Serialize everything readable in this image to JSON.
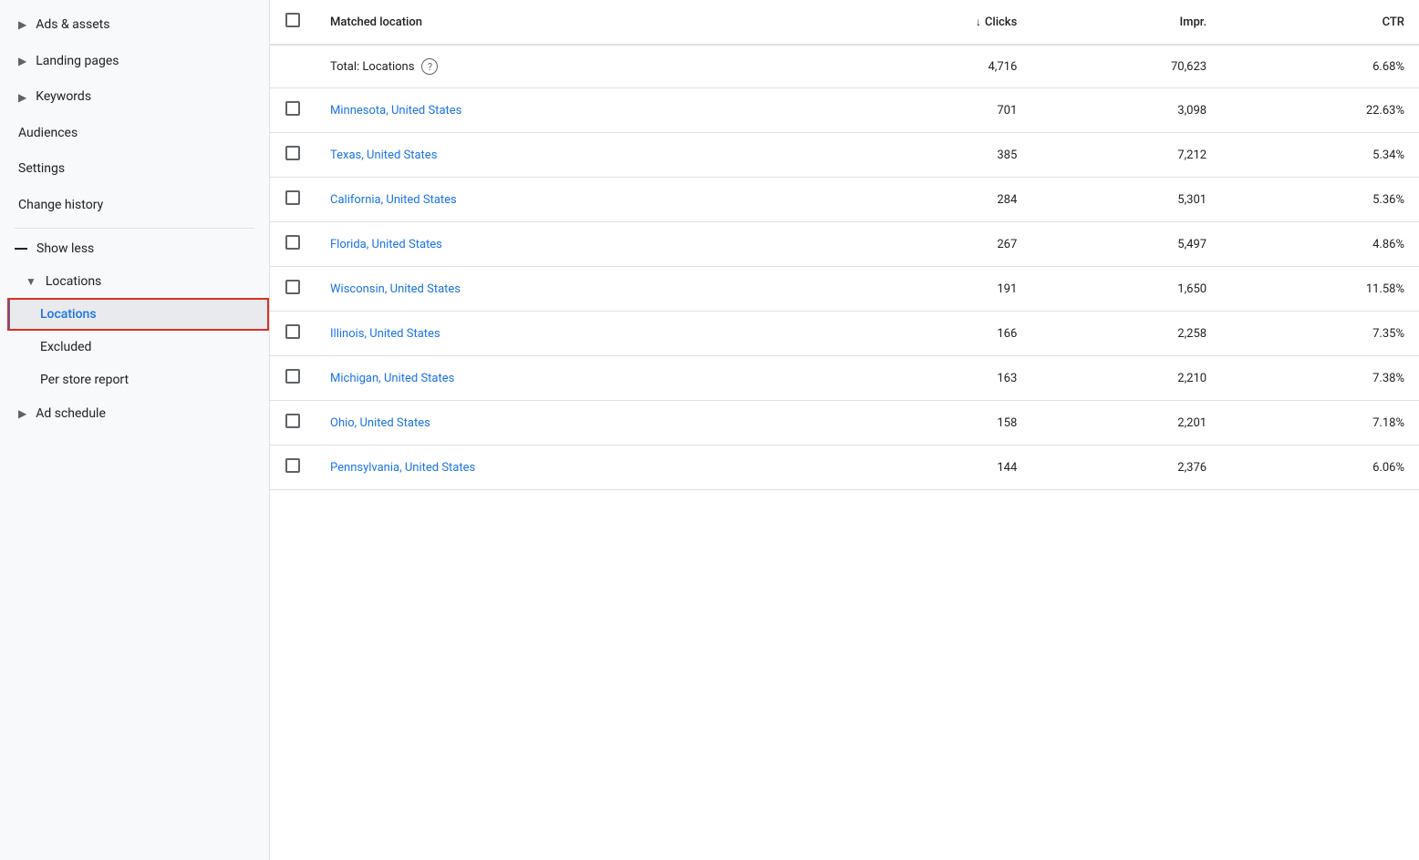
{
  "sidebar": {
    "items": [
      {
        "id": "ads-assets",
        "label": "Ads & assets",
        "type": "expand",
        "arrow": "▶"
      },
      {
        "id": "landing-pages",
        "label": "Landing pages",
        "type": "expand",
        "arrow": "▶"
      },
      {
        "id": "keywords",
        "label": "Keywords",
        "type": "expand",
        "arrow": "▶"
      },
      {
        "id": "audiences",
        "label": "Audiences",
        "type": "plain"
      },
      {
        "id": "settings",
        "label": "Settings",
        "type": "plain"
      },
      {
        "id": "change-history",
        "label": "Change history",
        "type": "plain"
      }
    ],
    "show_less_label": "Show less",
    "locations_section": {
      "header_label": "Locations",
      "arrow": "▼",
      "sub_items": [
        {
          "id": "locations",
          "label": "Locations",
          "active": true
        },
        {
          "id": "excluded",
          "label": "Excluded",
          "active": false
        },
        {
          "id": "per-store-report",
          "label": "Per store report",
          "active": false
        }
      ]
    },
    "ad_schedule": {
      "label": "Ad schedule",
      "arrow": "▶"
    }
  },
  "table": {
    "columns": [
      {
        "id": "checkbox",
        "label": "",
        "type": "checkbox"
      },
      {
        "id": "location",
        "label": "Matched location",
        "type": "text",
        "align": "left"
      },
      {
        "id": "clicks",
        "label": "Clicks",
        "sort": "desc",
        "align": "right"
      },
      {
        "id": "impr",
        "label": "Impr.",
        "align": "right"
      },
      {
        "id": "ctr",
        "label": "CTR",
        "align": "right"
      }
    ],
    "total_row": {
      "label": "Total: Locations",
      "clicks": "4,716",
      "impr": "70,623",
      "ctr": "6.68%"
    },
    "rows": [
      {
        "location": "Minnesota, United States",
        "clicks": "701",
        "impr": "3,098",
        "ctr": "22.63%"
      },
      {
        "location": "Texas, United States",
        "clicks": "385",
        "impr": "7,212",
        "ctr": "5.34%"
      },
      {
        "location": "California, United States",
        "clicks": "284",
        "impr": "5,301",
        "ctr": "5.36%"
      },
      {
        "location": "Florida, United States",
        "clicks": "267",
        "impr": "5,497",
        "ctr": "4.86%"
      },
      {
        "location": "Wisconsin, United States",
        "clicks": "191",
        "impr": "1,650",
        "ctr": "11.58%"
      },
      {
        "location": "Illinois, United States",
        "clicks": "166",
        "impr": "2,258",
        "ctr": "7.35%"
      },
      {
        "location": "Michigan, United States",
        "clicks": "163",
        "impr": "2,210",
        "ctr": "7.38%"
      },
      {
        "location": "Ohio, United States",
        "clicks": "158",
        "impr": "2,201",
        "ctr": "7.18%"
      },
      {
        "location": "Pennsylvania, United States",
        "clicks": "144",
        "impr": "2,376",
        "ctr": "6.06%"
      }
    ]
  }
}
